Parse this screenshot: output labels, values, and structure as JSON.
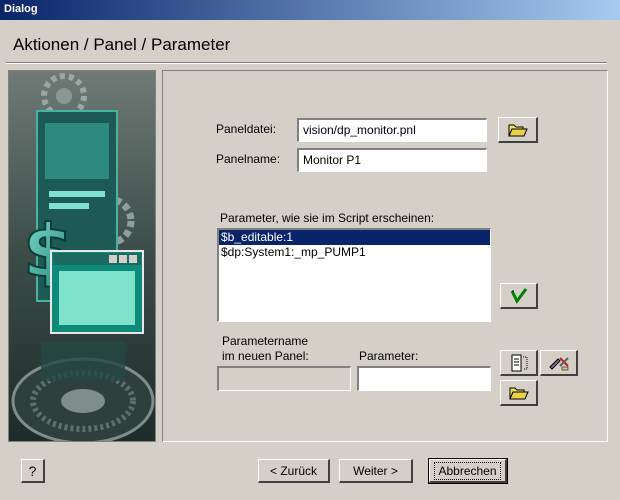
{
  "window": {
    "title": "Dialog"
  },
  "heading": "Aktionen / Panel / Parameter",
  "form": {
    "paneldatei_label": "Paneldatei:",
    "paneldatei_value": "vision/dp_monitor.pnl",
    "panelname_label": "Panelname:",
    "panelname_value": "Monitor P1",
    "params_label": "Parameter, wie sie im Script erscheinen:",
    "params": [
      "$b_editable:1",
      "$dp:System1:_mp_PUMP1"
    ],
    "paramname_label_1": "Parametername",
    "paramname_label_2": "im neuen Panel:",
    "parameter_label": "Parameter:",
    "paramname_value": "",
    "parameter_value": ""
  },
  "buttons": {
    "help": "?",
    "back": "< Zurück",
    "next": "Weiter >",
    "cancel": "Abbrechen"
  },
  "icons": {
    "open_file": "folder-open-icon",
    "apply": "checkmark-icon",
    "select_param": "parameter-list-icon",
    "edit": "edit-tools-icon"
  },
  "colors": {
    "title_start": "#0a246a",
    "title_end": "#a6caf0",
    "face": "#d4d0c8",
    "selection": "#0a246a"
  }
}
